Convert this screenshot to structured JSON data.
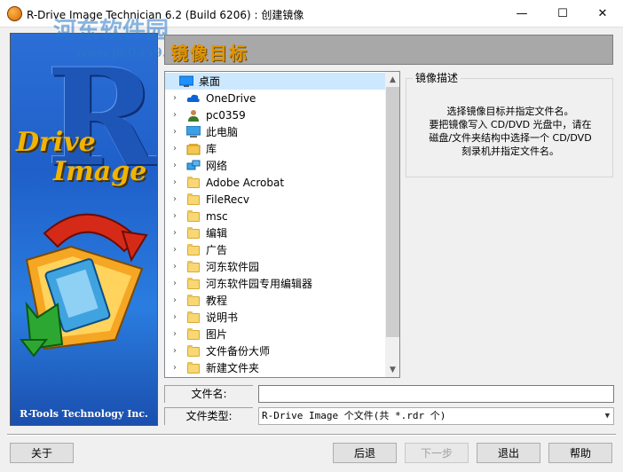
{
  "window": {
    "title": "R-Drive Image Technician 6.2 (Build 6206) : 创建镜像",
    "minimize_glyph": "—",
    "maximize_glyph": "☐",
    "close_glyph": "✕"
  },
  "watermark": {
    "main": "河东软件园",
    "url": "www.pc0359.cn"
  },
  "banner": {
    "drive": "Drive",
    "image": "Image",
    "footer": "R-Tools Technology Inc."
  },
  "header": {
    "title": "镜像目标"
  },
  "tree": {
    "items": [
      {
        "label": "桌面",
        "icon": "desktop-icon",
        "expandable": false,
        "selected": true
      },
      {
        "label": "OneDrive",
        "icon": "cloud-icon",
        "expandable": true
      },
      {
        "label": "pc0359",
        "icon": "user-icon",
        "expandable": true
      },
      {
        "label": "此电脑",
        "icon": "computer-icon",
        "expandable": true
      },
      {
        "label": "库",
        "icon": "library-icon",
        "expandable": true
      },
      {
        "label": "网络",
        "icon": "network-icon",
        "expandable": true
      },
      {
        "label": "Adobe Acrobat",
        "icon": "folder-icon",
        "expandable": true
      },
      {
        "label": "FileRecv",
        "icon": "folder-icon",
        "expandable": true
      },
      {
        "label": "msc",
        "icon": "folder-icon",
        "expandable": true
      },
      {
        "label": "编辑",
        "icon": "folder-icon",
        "expandable": true
      },
      {
        "label": "广告",
        "icon": "folder-icon",
        "expandable": true
      },
      {
        "label": "河东软件园",
        "icon": "folder-icon",
        "expandable": true
      },
      {
        "label": "河东软件园专用编辑器",
        "icon": "folder-icon",
        "expandable": true
      },
      {
        "label": "教程",
        "icon": "folder-icon",
        "expandable": true
      },
      {
        "label": "说明书",
        "icon": "folder-icon",
        "expandable": true
      },
      {
        "label": "图片",
        "icon": "folder-icon",
        "expandable": true
      },
      {
        "label": "文件备份大师",
        "icon": "folder-icon",
        "expandable": true
      },
      {
        "label": "新建文件夹",
        "icon": "folder-icon",
        "expandable": true
      }
    ]
  },
  "description": {
    "legend": "镜像描述",
    "lines": [
      "选择镜像目标并指定文件名。",
      "要把镜像写入 CD/DVD 光盘中，请在",
      "磁盘/文件夹结构中选择一个 CD/DVD",
      "刻录机并指定文件名。"
    ]
  },
  "filename": {
    "label": "文件名:",
    "value": ""
  },
  "filetype": {
    "label": "文件类型:",
    "value": "R-Drive Image 个文件(共 *.rdr 个)"
  },
  "buttons": {
    "about": "关于",
    "back": "后退",
    "next": "下一步",
    "exit": "退出",
    "help": "帮助"
  },
  "colors": {
    "banner_blue": "#1f5fc9",
    "header_gray": "#a8a8a8",
    "header_text": "#e39400"
  }
}
